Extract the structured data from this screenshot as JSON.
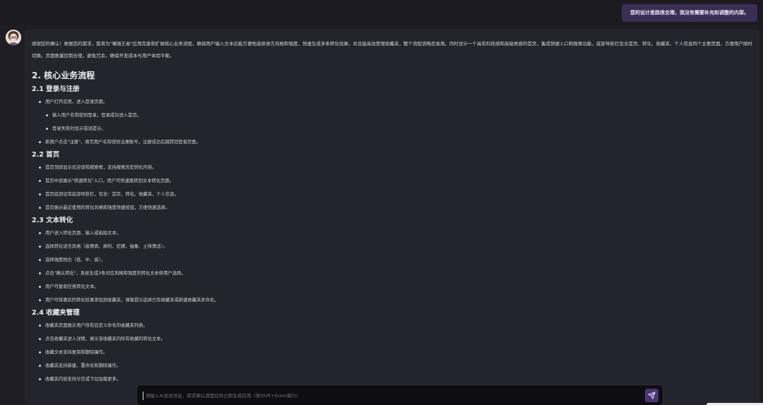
{
  "colors": {
    "background": "#1d1d23",
    "panel": "#24242c",
    "user_bubble": "#3a2e54",
    "send_button": "#4a3572"
  },
  "user_message": "您的设计思路很合理，我没有需要补充和调整的内容。",
  "assistant": {
    "avatar_icon": "assistant-avatar",
    "intro": "感谢您的确认！根据您的需求，我将为\"嘴强王者\"应用完善和扩展核心业务流程，确保用户输入文本后能方便地选择语言风格和强度，快速生成多条转化结果，并且能高效管理收藏夹，整个流程流畅且易用。同时设计一个具有科技感和高级质感的首页，集成快捷入口和搜索功能，底部导航栏包含首页、转化、收藏夹、个人信息四个主要页面，方便用户随时切换。页面数量控制合理，避免冗余，确保开发成本与用户体验平衡。",
    "section_title": "2. 核心业务流程",
    "login": {
      "title": "2.1 登录与注册",
      "item1": "用户打开应用，进入登录页面。",
      "sub1": "输入用户名和密码登录，登录成功进入首页。",
      "sub2": "登录失败时显示错误提示。",
      "item2": "新用户点击\"注册\"，填写用户名和密码注册账号，注册成功后跳转回登录页面。"
    },
    "home": {
      "title": "2.2 首页",
      "items": [
        "首页顶部显示欢迎语和搜索框，支持搜索历史转化内容。",
        "首页中部展示\"快速转化\"入口，用户可快速跳转到文本转化页面。",
        "首页底部设有底部导航栏，包含：首页、转化、收藏夹、个人信息。",
        "首页展示最近使用的转化风格和强度快捷按钮，方便快速选择。"
      ]
    },
    "convert": {
      "title": "2.3 文本转化",
      "items": [
        "用户进入转化页面，输入或粘贴文本。",
        "选择转化语言风格（高情商、犀利、杠精、抽象、土味情话）。",
        "选择强度档位（低、中、高）。",
        "点击\"确认转化\"，系统生成3条对应风格和强度的转化文本供用户选择。",
        "用户可复制任意转化文本。",
        "用户可将喜欢的转化结果添加到收藏夹，弹窗提示选择已有收藏夹或新建收藏夹并命名。"
      ]
    },
    "favorites": {
      "title": "2.4 收藏夹管理",
      "items": [
        "收藏夹页面展示用户所有自定义命名的收藏夹列表。",
        "点击收藏夹进入详情，展示该收藏夹内所有收藏的转化文本。",
        "收藏文本支持复制和删除操作。",
        "收藏夹支持新建、重命名和删除操作。",
        "收藏夹内容支持分页或下拉加载更多。"
      ]
    }
  },
  "input": {
    "placeholder": "请输入AI发送消息，需求确认清楚后将立即生成应用（按Shift+Enter换行）",
    "send_icon": "send-icon"
  }
}
